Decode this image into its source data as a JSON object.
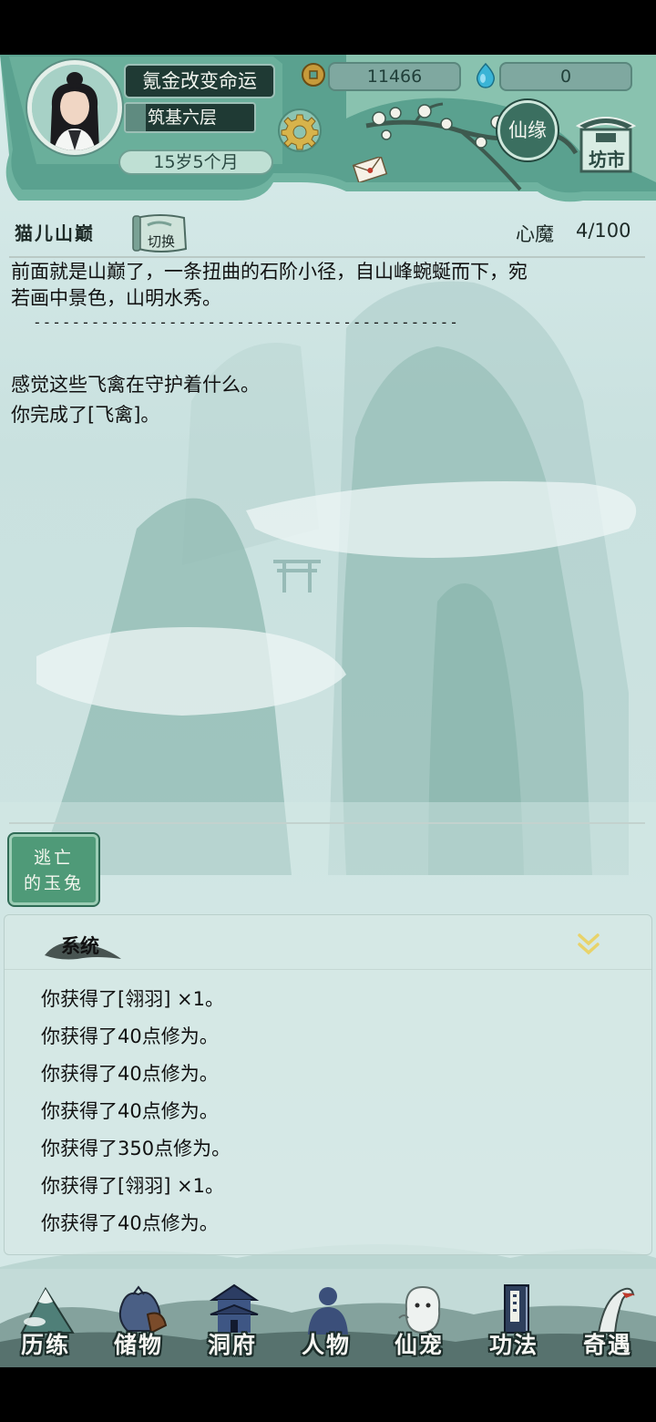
{
  "player": {
    "name": "氪金改变命运",
    "realm": "筑基六层",
    "age": "15岁5个月"
  },
  "resources": {
    "coins": "11466",
    "gems": "0"
  },
  "header_buttons": {
    "xianyuan": "仙缘",
    "fangshi": "坊市"
  },
  "location": {
    "name": "猫儿山巅",
    "switch_label": "切换",
    "xinmo_label": "心魔",
    "xinmo_value": "4/100"
  },
  "story": {
    "line1": "前面就是山巅了，一条扭曲的石阶小径，自山峰蜿蜒而下，宛",
    "line2": "若画中景色，山明水秀。",
    "separator": "--------------------------------------------",
    "line3": "感觉这些飞禽在守护着什么。",
    "line4": "你完成了[飞禽]。"
  },
  "action_button": {
    "line1": "逃亡",
    "line2": "的玉兔"
  },
  "system_log": {
    "title": "系统",
    "entries": [
      "你获得了[翎羽] ×1。",
      "你获得了40点修为。",
      "你获得了40点修为。",
      "你获得了40点修为。",
      "你获得了350点修为。",
      "你获得了[翎羽] ×1。",
      "你获得了40点修为。"
    ]
  },
  "nav": {
    "items": [
      {
        "label": "历练",
        "icon": "mountain-icon"
      },
      {
        "label": "储物",
        "icon": "pouch-icon"
      },
      {
        "label": "洞府",
        "icon": "pagoda-icon"
      },
      {
        "label": "人物",
        "icon": "person-icon"
      },
      {
        "label": "仙宠",
        "icon": "spirit-pet-icon"
      },
      {
        "label": "功法",
        "icon": "book-icon"
      },
      {
        "label": "奇遇",
        "icon": "crane-icon"
      }
    ]
  },
  "colors": {
    "panel_teal": "#5fa592",
    "dark_box": "#1f3a34",
    "flee_button": "#4f9a78",
    "collapse_arrow": "#e8d36a"
  }
}
